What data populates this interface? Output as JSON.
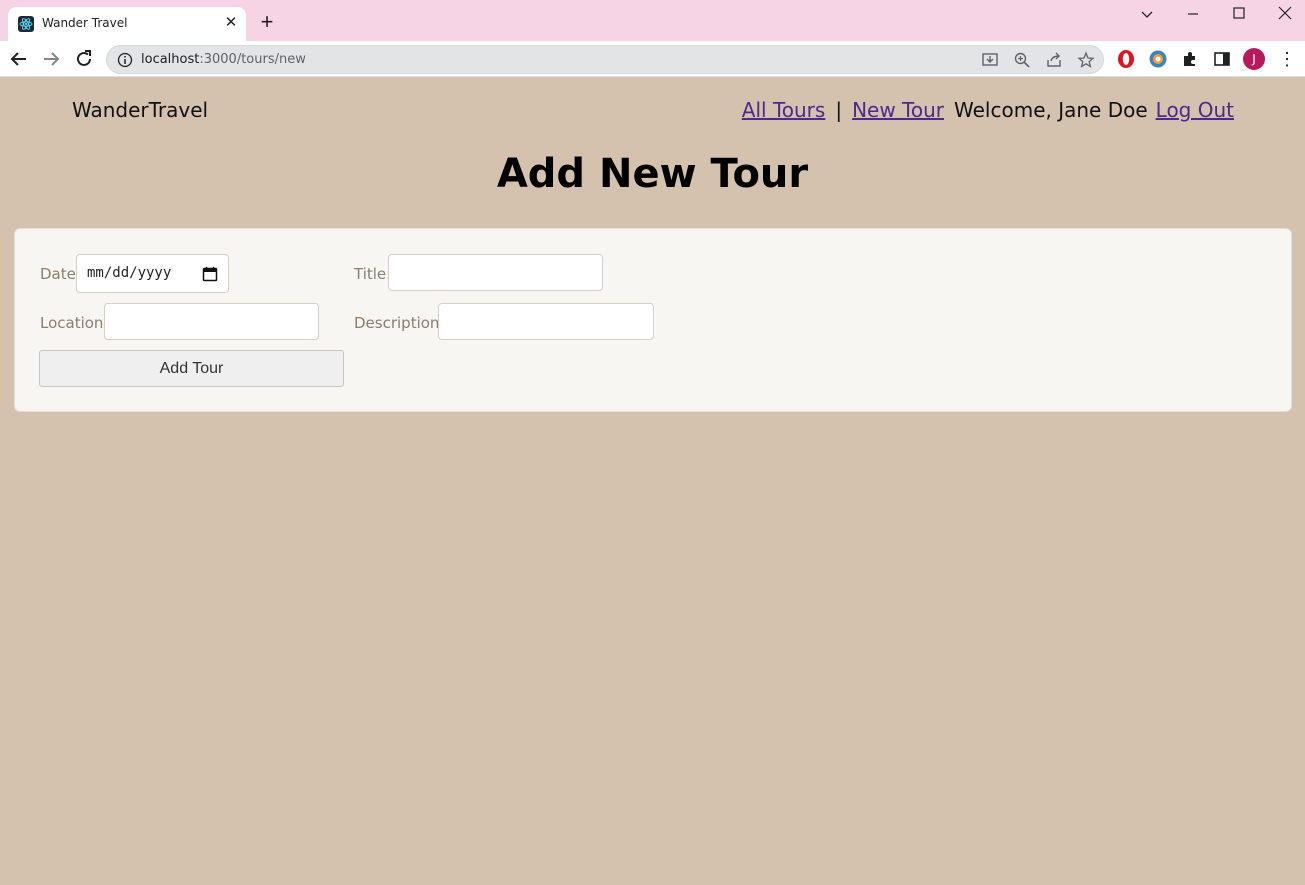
{
  "browser": {
    "tab_title": "Wander Travel",
    "url_host": "localhost",
    "url_path": ":3000/tours/new",
    "profile_initial": "J"
  },
  "header": {
    "brand": "WanderTravel",
    "nav": {
      "all_tours": "All Tours",
      "separator": "|",
      "new_tour": "New Tour",
      "welcome": "Welcome, Jane Doe",
      "log_out": "Log Out"
    }
  },
  "main": {
    "title": "Add New Tour",
    "form": {
      "date_label": "Date:",
      "date_placeholder": "mm/dd/yyyy",
      "title_label": "Title:",
      "title_value": "",
      "location_label": "Location:",
      "location_value": "",
      "description_label": "Description:",
      "description_value": "",
      "submit_label": "Add Tour"
    }
  },
  "colors": {
    "page_background": "#d4c1ae",
    "card_background": "#f8f6f3",
    "link": "#4b2a8a",
    "tabbar": "#f7d4e5"
  },
  "icons": [
    "react-favicon-icon",
    "close-icon",
    "plus-icon",
    "chevron-down-icon",
    "minimize-icon",
    "maximize-icon",
    "window-close-icon",
    "back-arrow-icon",
    "forward-arrow-icon",
    "reload-icon",
    "info-icon",
    "install-icon",
    "zoom-icon",
    "share-icon",
    "star-icon",
    "opera-extension-icon",
    "chrome-extension-icon",
    "puzzle-icon",
    "side-panel-icon",
    "calendar-icon",
    "kebab-menu-icon"
  ]
}
